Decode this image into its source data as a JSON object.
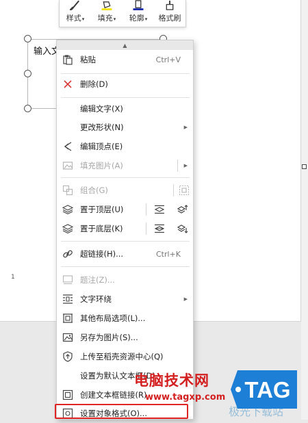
{
  "toolbar": {
    "buttons": [
      {
        "label": "样式",
        "icon": "brush-style-icon",
        "dropdown": true
      },
      {
        "label": "填充",
        "icon": "fill-bucket-icon",
        "dropdown": true
      },
      {
        "label": "轮廓",
        "icon": "outline-pen-icon",
        "dropdown": true
      },
      {
        "label": "格式刷",
        "icon": "format-painter-icon",
        "dropdown": false
      }
    ]
  },
  "canvas": {
    "textbox_text": "输入文",
    "page_number": "1"
  },
  "menu": {
    "paste": {
      "label": "粘贴",
      "shortcut": "Ctrl+V"
    },
    "delete": {
      "label": "删除(D)"
    },
    "edit_text": {
      "label": "编辑文字(X)"
    },
    "change_shape": {
      "label": "更改形状(N)"
    },
    "edit_points": {
      "label": "编辑顶点(E)"
    },
    "fill_picture": {
      "label": "填充图片(A)"
    },
    "group": {
      "label": "组合(G)"
    },
    "bring_front": {
      "label": "置于顶层(U)"
    },
    "send_back": {
      "label": "置于底层(K)"
    },
    "hyperlink": {
      "label": "超链接(H)...",
      "shortcut": "Ctrl+K"
    },
    "caption": {
      "label": "题注(Z)..."
    },
    "text_wrap": {
      "label": "文字环绕"
    },
    "more_layout": {
      "label": "其他布局选项(L)..."
    },
    "save_as_picture": {
      "label": "另存为图片(S)..."
    },
    "upload": {
      "label": "上传至稻壳资源中心(Q)"
    },
    "set_default": {
      "label": "设置为默认文本框(D)"
    },
    "create_link": {
      "label": "创建文本框链接(R)"
    },
    "format_object": {
      "label": "设置对象格式(O)..."
    }
  },
  "watermark": {
    "site_name": "电脑技术网",
    "site_url": "www.tagxp.com",
    "logo_text": "TAG",
    "faint_text": "极光下载站",
    "logo_color": "#1e7fd6",
    "text_color": "#d31f1f"
  }
}
